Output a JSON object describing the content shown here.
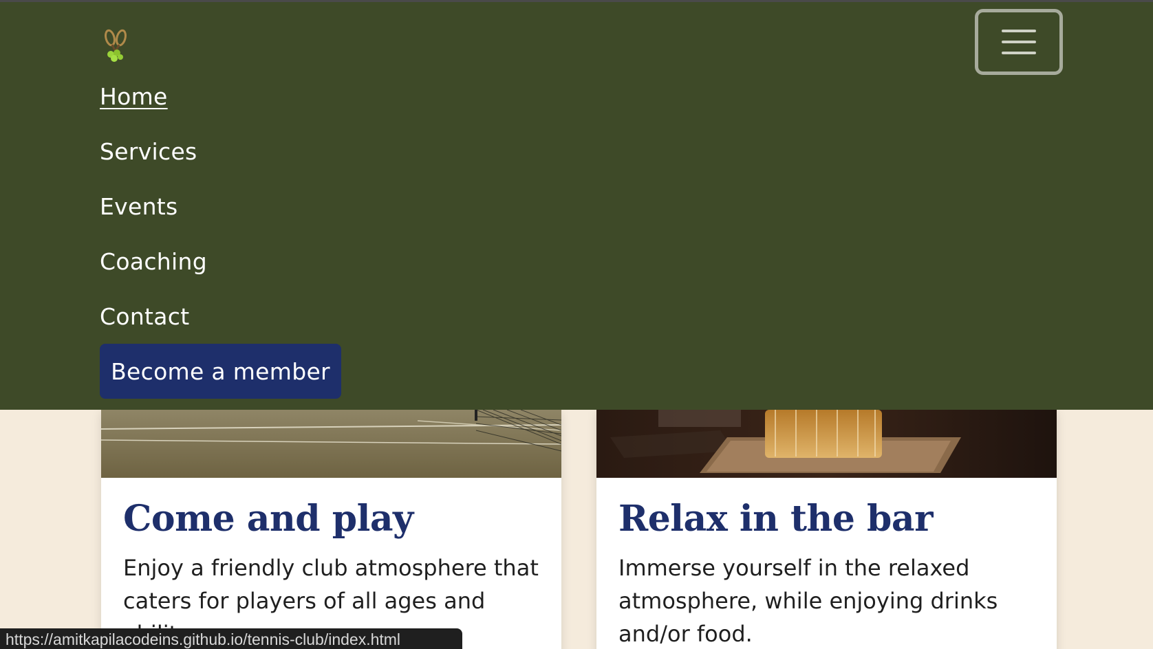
{
  "nav": {
    "items": [
      {
        "label": "Home",
        "active": true
      },
      {
        "label": "Services"
      },
      {
        "label": "Events"
      },
      {
        "label": "Coaching"
      },
      {
        "label": "Contact"
      }
    ],
    "cta_label": "Become a member",
    "toggler_icon": "hamburger-icon",
    "logo_icon": "tennis-rackets-logo"
  },
  "cards": [
    {
      "title": "Come and play",
      "text": "Enjoy a friendly club atmosphere that caters for players of all ages and ability.",
      "image": "tennis-court-net"
    },
    {
      "title": "Relax in the bar",
      "text": "Immerse yourself in the relaxed atmosphere, while enjoying drinks and/or food.",
      "image": "whisky-glass-on-coaster"
    }
  ],
  "status_url": "https://amitkapilacodeins.github.io/tennis-club/index.html",
  "colors": {
    "navbar_bg": "#3e4a28",
    "cta_bg": "#1e2f6b",
    "page_bg": "#f5ebdc",
    "title_color": "#1e2f6b"
  }
}
